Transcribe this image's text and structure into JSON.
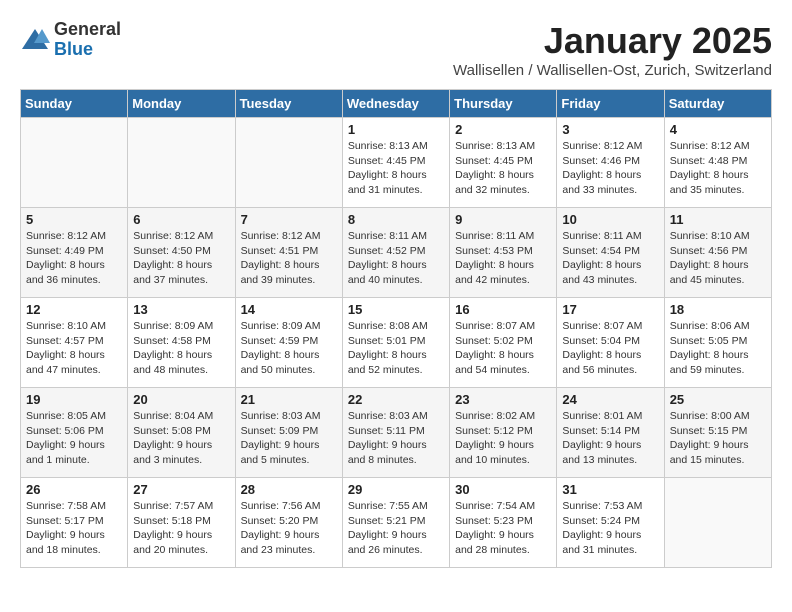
{
  "header": {
    "logo_general": "General",
    "logo_blue": "Blue",
    "title": "January 2025",
    "subtitle": "Wallisellen / Wallisellen-Ost, Zurich, Switzerland"
  },
  "days_of_week": [
    "Sunday",
    "Monday",
    "Tuesday",
    "Wednesday",
    "Thursday",
    "Friday",
    "Saturday"
  ],
  "weeks": [
    [
      {
        "day": "",
        "info": ""
      },
      {
        "day": "",
        "info": ""
      },
      {
        "day": "",
        "info": ""
      },
      {
        "day": "1",
        "info": "Sunrise: 8:13 AM\nSunset: 4:45 PM\nDaylight: 8 hours\nand 31 minutes."
      },
      {
        "day": "2",
        "info": "Sunrise: 8:13 AM\nSunset: 4:45 PM\nDaylight: 8 hours\nand 32 minutes."
      },
      {
        "day": "3",
        "info": "Sunrise: 8:12 AM\nSunset: 4:46 PM\nDaylight: 8 hours\nand 33 minutes."
      },
      {
        "day": "4",
        "info": "Sunrise: 8:12 AM\nSunset: 4:48 PM\nDaylight: 8 hours\nand 35 minutes."
      }
    ],
    [
      {
        "day": "5",
        "info": "Sunrise: 8:12 AM\nSunset: 4:49 PM\nDaylight: 8 hours\nand 36 minutes."
      },
      {
        "day": "6",
        "info": "Sunrise: 8:12 AM\nSunset: 4:50 PM\nDaylight: 8 hours\nand 37 minutes."
      },
      {
        "day": "7",
        "info": "Sunrise: 8:12 AM\nSunset: 4:51 PM\nDaylight: 8 hours\nand 39 minutes."
      },
      {
        "day": "8",
        "info": "Sunrise: 8:11 AM\nSunset: 4:52 PM\nDaylight: 8 hours\nand 40 minutes."
      },
      {
        "day": "9",
        "info": "Sunrise: 8:11 AM\nSunset: 4:53 PM\nDaylight: 8 hours\nand 42 minutes."
      },
      {
        "day": "10",
        "info": "Sunrise: 8:11 AM\nSunset: 4:54 PM\nDaylight: 8 hours\nand 43 minutes."
      },
      {
        "day": "11",
        "info": "Sunrise: 8:10 AM\nSunset: 4:56 PM\nDaylight: 8 hours\nand 45 minutes."
      }
    ],
    [
      {
        "day": "12",
        "info": "Sunrise: 8:10 AM\nSunset: 4:57 PM\nDaylight: 8 hours\nand 47 minutes."
      },
      {
        "day": "13",
        "info": "Sunrise: 8:09 AM\nSunset: 4:58 PM\nDaylight: 8 hours\nand 48 minutes."
      },
      {
        "day": "14",
        "info": "Sunrise: 8:09 AM\nSunset: 4:59 PM\nDaylight: 8 hours\nand 50 minutes."
      },
      {
        "day": "15",
        "info": "Sunrise: 8:08 AM\nSunset: 5:01 PM\nDaylight: 8 hours\nand 52 minutes."
      },
      {
        "day": "16",
        "info": "Sunrise: 8:07 AM\nSunset: 5:02 PM\nDaylight: 8 hours\nand 54 minutes."
      },
      {
        "day": "17",
        "info": "Sunrise: 8:07 AM\nSunset: 5:04 PM\nDaylight: 8 hours\nand 56 minutes."
      },
      {
        "day": "18",
        "info": "Sunrise: 8:06 AM\nSunset: 5:05 PM\nDaylight: 8 hours\nand 59 minutes."
      }
    ],
    [
      {
        "day": "19",
        "info": "Sunrise: 8:05 AM\nSunset: 5:06 PM\nDaylight: 9 hours\nand 1 minute."
      },
      {
        "day": "20",
        "info": "Sunrise: 8:04 AM\nSunset: 5:08 PM\nDaylight: 9 hours\nand 3 minutes."
      },
      {
        "day": "21",
        "info": "Sunrise: 8:03 AM\nSunset: 5:09 PM\nDaylight: 9 hours\nand 5 minutes."
      },
      {
        "day": "22",
        "info": "Sunrise: 8:03 AM\nSunset: 5:11 PM\nDaylight: 9 hours\nand 8 minutes."
      },
      {
        "day": "23",
        "info": "Sunrise: 8:02 AM\nSunset: 5:12 PM\nDaylight: 9 hours\nand 10 minutes."
      },
      {
        "day": "24",
        "info": "Sunrise: 8:01 AM\nSunset: 5:14 PM\nDaylight: 9 hours\nand 13 minutes."
      },
      {
        "day": "25",
        "info": "Sunrise: 8:00 AM\nSunset: 5:15 PM\nDaylight: 9 hours\nand 15 minutes."
      }
    ],
    [
      {
        "day": "26",
        "info": "Sunrise: 7:58 AM\nSunset: 5:17 PM\nDaylight: 9 hours\nand 18 minutes."
      },
      {
        "day": "27",
        "info": "Sunrise: 7:57 AM\nSunset: 5:18 PM\nDaylight: 9 hours\nand 20 minutes."
      },
      {
        "day": "28",
        "info": "Sunrise: 7:56 AM\nSunset: 5:20 PM\nDaylight: 9 hours\nand 23 minutes."
      },
      {
        "day": "29",
        "info": "Sunrise: 7:55 AM\nSunset: 5:21 PM\nDaylight: 9 hours\nand 26 minutes."
      },
      {
        "day": "30",
        "info": "Sunrise: 7:54 AM\nSunset: 5:23 PM\nDaylight: 9 hours\nand 28 minutes."
      },
      {
        "day": "31",
        "info": "Sunrise: 7:53 AM\nSunset: 5:24 PM\nDaylight: 9 hours\nand 31 minutes."
      },
      {
        "day": "",
        "info": ""
      }
    ]
  ]
}
